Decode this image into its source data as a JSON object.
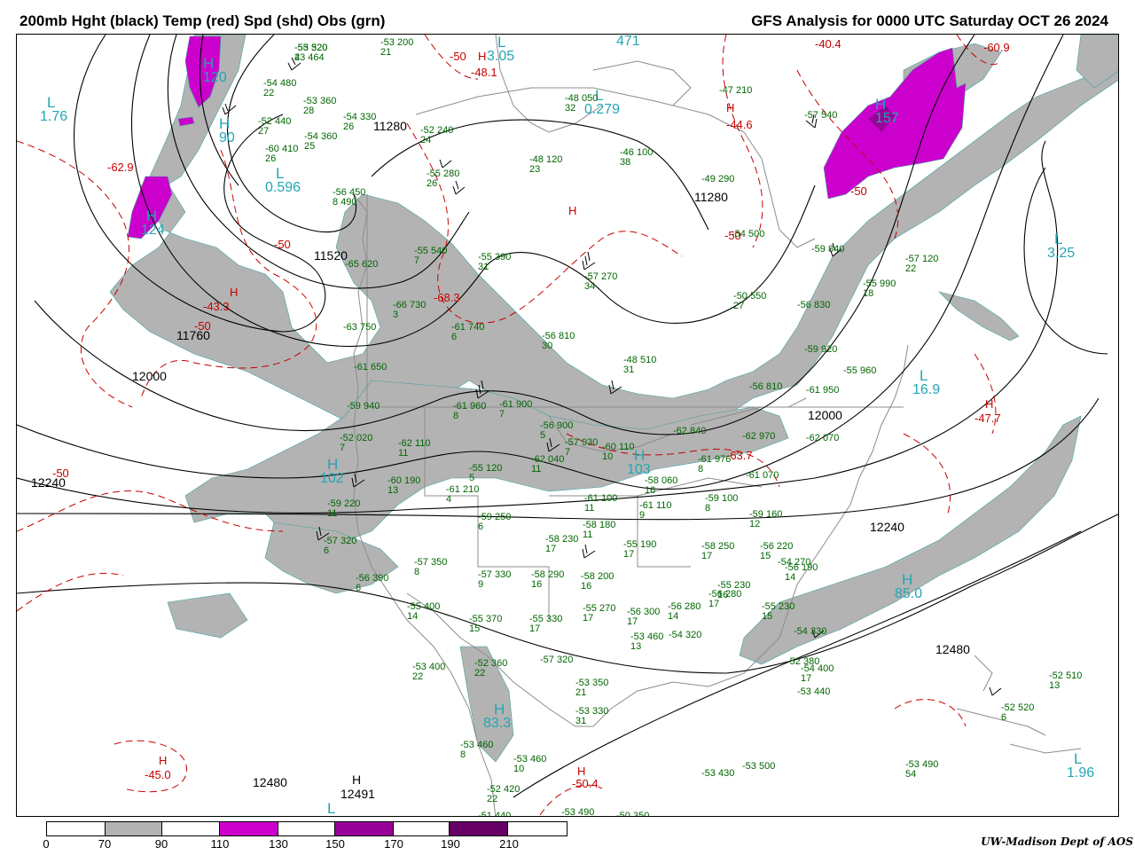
{
  "header": {
    "left_title": "200mb Hght (black) Temp (red) Spd (shd) Obs (grn)",
    "right_title": "GFS Analysis for 0000 UTC Saturday  OCT 26 2024"
  },
  "colors": {
    "height_contour": "#000000",
    "temperature_contour": "#c80000",
    "speed_70_90": "#b3b3b3",
    "speed_110_130": "#cc00cc",
    "speed_150_170": "#990099",
    "speed_190_210": "#660066",
    "observations": "#006600",
    "centers": "#22a6b3",
    "geography": "#8c8c8c"
  },
  "height_labels": [
    "11280",
    "11520",
    "11760",
    "12000",
    "12240",
    "12480",
    "11280",
    "12000",
    "12240",
    "12480",
    "12491",
    "12480"
  ],
  "temperature_labels": [
    "-62.9",
    "-50",
    "-50",
    "-43.3",
    "-50",
    "-68.3",
    "-48.1",
    "-50",
    "-44.6",
    "-40.4",
    "-60.9",
    "-50",
    "-47.7",
    "-50",
    "-45.0",
    "-50.4",
    "-63.7"
  ],
  "highs_lows": [
    {
      "letter": "L",
      "value": "1.76"
    },
    {
      "letter": "H",
      "value": "120"
    },
    {
      "letter": "H",
      "value": "90"
    },
    {
      "letter": "L",
      "value": "0.596"
    },
    {
      "letter": "H",
      "value": "124"
    },
    {
      "letter": "L",
      "value": "3.05"
    },
    {
      "letter": "L",
      "value": "0.279"
    },
    {
      "letter": "H",
      "value": "471"
    },
    {
      "letter": "H",
      "value": "157"
    },
    {
      "letter": "L",
      "value": "3.25"
    },
    {
      "letter": "L",
      "value": "16.9"
    },
    {
      "letter": "H",
      "value": "102"
    },
    {
      "letter": "H",
      "value": "103"
    },
    {
      "letter": "H",
      "value": "85.0"
    },
    {
      "letter": "H",
      "value": "83.3"
    },
    {
      "letter": "L",
      "value": "1.96"
    },
    {
      "letter": "H",
      "value": "12491"
    },
    {
      "letter": "L",
      "value": ""
    }
  ],
  "observations": [
    [
      "-55",
      "23",
      "464",
      "320"
    ],
    [
      "-53",
      "21",
      "200"
    ],
    [
      "-54",
      "22",
      "480"
    ],
    [
      "-53",
      "28",
      "360"
    ],
    [
      "-52",
      "27",
      "440"
    ],
    [
      "-54",
      "26",
      "330"
    ],
    [
      "-54",
      "25",
      "360"
    ],
    [
      "-60",
      "26",
      "410"
    ],
    [
      "-52",
      "24",
      "240"
    ],
    [
      "-55",
      "26",
      "280"
    ],
    [
      "-48",
      "32",
      "050"
    ],
    [
      "-46",
      "38",
      "100"
    ],
    [
      "-48",
      "23",
      "120"
    ],
    [
      "-47",
      "210"
    ],
    [
      "-57",
      "540"
    ],
    [
      "-49",
      "290"
    ],
    [
      "-56",
      "8",
      "490",
      "450"
    ],
    [
      "-55",
      "7",
      "540"
    ],
    [
      "-55",
      "31",
      "390"
    ],
    [
      "-57",
      "34",
      "270"
    ],
    [
      "-65",
      "620"
    ],
    [
      "-66",
      "3",
      "730"
    ],
    [
      "-61",
      "6",
      "740"
    ],
    [
      "-63",
      "750"
    ],
    [
      "-56",
      "30",
      "810"
    ],
    [
      "-48",
      "31",
      "510"
    ],
    [
      "-54",
      "500"
    ],
    [
      "-59",
      "840"
    ],
    [
      "-55",
      "18",
      "990"
    ],
    [
      "-57",
      "22",
      "120"
    ],
    [
      "-50",
      "27",
      "550"
    ],
    [
      "-56",
      "830"
    ],
    [
      "-61",
      "650"
    ],
    [
      "-59",
      "940"
    ],
    [
      "-61",
      "8",
      "960"
    ],
    [
      "-61",
      "7",
      "900"
    ],
    [
      "-59",
      "920"
    ],
    [
      "-55",
      "960"
    ],
    [
      "-56",
      "810"
    ],
    [
      "-61",
      "950"
    ],
    [
      "-52",
      "7",
      "020"
    ],
    [
      "-62",
      "11",
      "110"
    ],
    [
      "-55",
      "5",
      "120"
    ],
    [
      "-62",
      "11",
      "040"
    ],
    [
      "-56",
      "5",
      "900"
    ],
    [
      "-57",
      "7",
      "930"
    ],
    [
      "-60",
      "10",
      "110"
    ],
    [
      "-58",
      "16",
      "060"
    ],
    [
      "-61",
      "8",
      "976"
    ],
    [
      "-62",
      "070"
    ],
    [
      "-62",
      "970"
    ],
    [
      "-62",
      "840"
    ],
    [
      "-59",
      "11",
      "220"
    ],
    [
      "-60",
      "13",
      "190"
    ],
    [
      "-61",
      "4",
      "210"
    ],
    [
      "-59",
      "6",
      "250"
    ],
    [
      "-57",
      "6",
      "320"
    ],
    [
      "-57",
      "8",
      "350"
    ],
    [
      "-57",
      "9",
      "330"
    ],
    [
      "-56",
      "6",
      "390"
    ],
    [
      "-55",
      "14",
      "400"
    ],
    [
      "-55",
      "15",
      "370"
    ],
    [
      "-55",
      "17",
      "330"
    ],
    [
      "-58",
      "16",
      "290"
    ],
    [
      "-58",
      "17",
      "230"
    ],
    [
      "-58",
      "11",
      "180"
    ],
    [
      "-61",
      "11",
      "100"
    ],
    [
      "-61",
      "9",
      "110"
    ],
    [
      "-59",
      "8",
      "100"
    ],
    [
      "-61",
      "070"
    ],
    [
      "-59",
      "12",
      "160"
    ],
    [
      "-56",
      "14",
      "190"
    ],
    [
      "-56",
      "15",
      "220"
    ],
    [
      "-54",
      "270"
    ],
    [
      "-58",
      "17",
      "250"
    ],
    [
      "-55",
      "17",
      "190"
    ],
    [
      "-58",
      "16",
      "200"
    ],
    [
      "-55",
      "17",
      "270"
    ],
    [
      "-56",
      "17",
      "300"
    ],
    [
      "-56",
      "14",
      "280"
    ],
    [
      "-56",
      "17",
      "280"
    ],
    [
      "-55",
      "16",
      "230"
    ],
    [
      "-55",
      "15",
      "230"
    ],
    [
      "-54",
      "330"
    ],
    [
      "-52",
      "380"
    ],
    [
      "-54",
      "17",
      "400"
    ],
    [
      "-53",
      "440"
    ],
    [
      "-53",
      "13",
      "460"
    ],
    [
      "-54",
      "320"
    ],
    [
      "-57",
      "320"
    ],
    [
      "-53",
      "21",
      "350"
    ],
    [
      "-53",
      "31",
      "330"
    ],
    [
      "-52",
      "22",
      "360"
    ],
    [
      "-53",
      "22",
      "400"
    ],
    [
      "-53",
      "8",
      "460"
    ],
    [
      "-53",
      "10",
      "460"
    ],
    [
      "-52",
      "22",
      "420"
    ],
    [
      "-51",
      "26",
      "440"
    ],
    [
      "-53",
      "20",
      "490"
    ],
    [
      "-50",
      "350"
    ],
    [
      "-53",
      "430"
    ],
    [
      "-53",
      "500"
    ],
    [
      "-53",
      "54",
      "490"
    ],
    [
      "-52",
      "6",
      "520"
    ],
    [
      "-52",
      "13",
      "510"
    ],
    [
      "-53",
      "4",
      "520"
    ]
  ],
  "legend": {
    "bins": [
      {
        "from": "0",
        "to": "70",
        "color": "#ffffff"
      },
      {
        "from": "70",
        "to": "90",
        "color": "#b3b3b3"
      },
      {
        "from": "90",
        "to": "110",
        "color": "#ffffff"
      },
      {
        "from": "110",
        "to": "130",
        "color": "#cc00cc"
      },
      {
        "from": "130",
        "to": "150",
        "color": "#ffffff"
      },
      {
        "from": "150",
        "to": "170",
        "color": "#990099"
      },
      {
        "from": "170",
        "to": "190",
        "color": "#ffffff"
      },
      {
        "from": "190",
        "to": "210",
        "color": "#660066"
      },
      {
        "from": "210",
        "to": "",
        "color": "#ffffff"
      }
    ],
    "ticks": [
      "0",
      "70",
      "90",
      "110",
      "130",
      "150",
      "170",
      "190",
      "210"
    ]
  },
  "credit": "UW-Madison   Dept of AOS"
}
